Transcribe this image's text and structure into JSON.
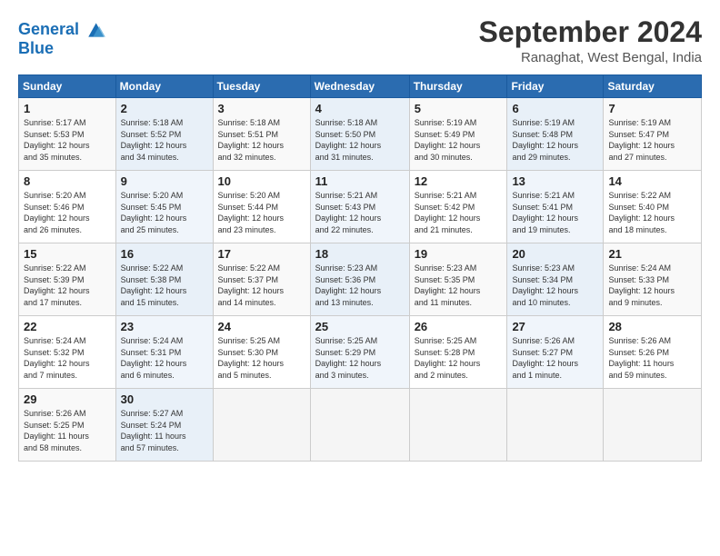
{
  "header": {
    "logo_line1": "General",
    "logo_line2": "Blue",
    "main_title": "September 2024",
    "subtitle": "Ranaghat, West Bengal, India"
  },
  "weekdays": [
    "Sunday",
    "Monday",
    "Tuesday",
    "Wednesday",
    "Thursday",
    "Friday",
    "Saturday"
  ],
  "weeks": [
    [
      {
        "day": "1",
        "info": "Sunrise: 5:17 AM\nSunset: 5:53 PM\nDaylight: 12 hours\nand 35 minutes."
      },
      {
        "day": "2",
        "info": "Sunrise: 5:18 AM\nSunset: 5:52 PM\nDaylight: 12 hours\nand 34 minutes."
      },
      {
        "day": "3",
        "info": "Sunrise: 5:18 AM\nSunset: 5:51 PM\nDaylight: 12 hours\nand 32 minutes."
      },
      {
        "day": "4",
        "info": "Sunrise: 5:18 AM\nSunset: 5:50 PM\nDaylight: 12 hours\nand 31 minutes."
      },
      {
        "day": "5",
        "info": "Sunrise: 5:19 AM\nSunset: 5:49 PM\nDaylight: 12 hours\nand 30 minutes."
      },
      {
        "day": "6",
        "info": "Sunrise: 5:19 AM\nSunset: 5:48 PM\nDaylight: 12 hours\nand 29 minutes."
      },
      {
        "day": "7",
        "info": "Sunrise: 5:19 AM\nSunset: 5:47 PM\nDaylight: 12 hours\nand 27 minutes."
      }
    ],
    [
      {
        "day": "8",
        "info": "Sunrise: 5:20 AM\nSunset: 5:46 PM\nDaylight: 12 hours\nand 26 minutes."
      },
      {
        "day": "9",
        "info": "Sunrise: 5:20 AM\nSunset: 5:45 PM\nDaylight: 12 hours\nand 25 minutes."
      },
      {
        "day": "10",
        "info": "Sunrise: 5:20 AM\nSunset: 5:44 PM\nDaylight: 12 hours\nand 23 minutes."
      },
      {
        "day": "11",
        "info": "Sunrise: 5:21 AM\nSunset: 5:43 PM\nDaylight: 12 hours\nand 22 minutes."
      },
      {
        "day": "12",
        "info": "Sunrise: 5:21 AM\nSunset: 5:42 PM\nDaylight: 12 hours\nand 21 minutes."
      },
      {
        "day": "13",
        "info": "Sunrise: 5:21 AM\nSunset: 5:41 PM\nDaylight: 12 hours\nand 19 minutes."
      },
      {
        "day": "14",
        "info": "Sunrise: 5:22 AM\nSunset: 5:40 PM\nDaylight: 12 hours\nand 18 minutes."
      }
    ],
    [
      {
        "day": "15",
        "info": "Sunrise: 5:22 AM\nSunset: 5:39 PM\nDaylight: 12 hours\nand 17 minutes."
      },
      {
        "day": "16",
        "info": "Sunrise: 5:22 AM\nSunset: 5:38 PM\nDaylight: 12 hours\nand 15 minutes."
      },
      {
        "day": "17",
        "info": "Sunrise: 5:22 AM\nSunset: 5:37 PM\nDaylight: 12 hours\nand 14 minutes."
      },
      {
        "day": "18",
        "info": "Sunrise: 5:23 AM\nSunset: 5:36 PM\nDaylight: 12 hours\nand 13 minutes."
      },
      {
        "day": "19",
        "info": "Sunrise: 5:23 AM\nSunset: 5:35 PM\nDaylight: 12 hours\nand 11 minutes."
      },
      {
        "day": "20",
        "info": "Sunrise: 5:23 AM\nSunset: 5:34 PM\nDaylight: 12 hours\nand 10 minutes."
      },
      {
        "day": "21",
        "info": "Sunrise: 5:24 AM\nSunset: 5:33 PM\nDaylight: 12 hours\nand 9 minutes."
      }
    ],
    [
      {
        "day": "22",
        "info": "Sunrise: 5:24 AM\nSunset: 5:32 PM\nDaylight: 12 hours\nand 7 minutes."
      },
      {
        "day": "23",
        "info": "Sunrise: 5:24 AM\nSunset: 5:31 PM\nDaylight: 12 hours\nand 6 minutes."
      },
      {
        "day": "24",
        "info": "Sunrise: 5:25 AM\nSunset: 5:30 PM\nDaylight: 12 hours\nand 5 minutes."
      },
      {
        "day": "25",
        "info": "Sunrise: 5:25 AM\nSunset: 5:29 PM\nDaylight: 12 hours\nand 3 minutes."
      },
      {
        "day": "26",
        "info": "Sunrise: 5:25 AM\nSunset: 5:28 PM\nDaylight: 12 hours\nand 2 minutes."
      },
      {
        "day": "27",
        "info": "Sunrise: 5:26 AM\nSunset: 5:27 PM\nDaylight: 12 hours\nand 1 minute."
      },
      {
        "day": "28",
        "info": "Sunrise: 5:26 AM\nSunset: 5:26 PM\nDaylight: 11 hours\nand 59 minutes."
      }
    ],
    [
      {
        "day": "29",
        "info": "Sunrise: 5:26 AM\nSunset: 5:25 PM\nDaylight: 11 hours\nand 58 minutes."
      },
      {
        "day": "30",
        "info": "Sunrise: 5:27 AM\nSunset: 5:24 PM\nDaylight: 11 hours\nand 57 minutes."
      },
      {
        "day": "",
        "info": ""
      },
      {
        "day": "",
        "info": ""
      },
      {
        "day": "",
        "info": ""
      },
      {
        "day": "",
        "info": ""
      },
      {
        "day": "",
        "info": ""
      }
    ]
  ]
}
